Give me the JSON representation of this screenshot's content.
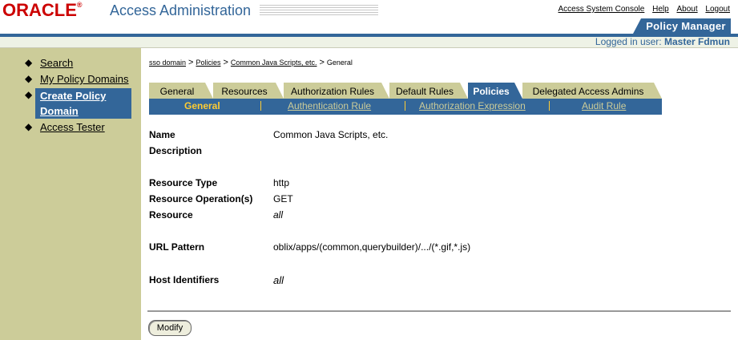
{
  "header": {
    "logo_text": "ORACLE",
    "logo_reg": "®",
    "app_title": "Access Administration",
    "global_links": [
      "Access System Console",
      "Help",
      "About",
      "Logout"
    ],
    "section_tab": "Policy Manager",
    "logged_label": "Logged in user:",
    "logged_user": "Master Fdmun"
  },
  "sidebar": {
    "items": [
      {
        "label": "Search",
        "active": false
      },
      {
        "label": "My Policy Domains",
        "active": false
      },
      {
        "label": "Create Policy Domain",
        "line1": "Create Policy",
        "line2": "Domain",
        "active": true
      },
      {
        "label": "Access Tester",
        "active": false
      }
    ]
  },
  "breadcrumb": {
    "items": [
      "sso domain",
      "Policies",
      "Common Java Scripts, etc."
    ],
    "current": "General",
    "separator": ">"
  },
  "tabs": [
    {
      "label": "General",
      "active": false
    },
    {
      "label": "Resources",
      "active": false
    },
    {
      "label": "Authorization Rules",
      "active": false
    },
    {
      "label": "Default Rules",
      "active": false
    },
    {
      "label": "Policies",
      "active": true
    },
    {
      "label": "Delegated Access Admins",
      "active": false
    }
  ],
  "subtabs": [
    {
      "label": "General",
      "active": true
    },
    {
      "label": "Authentication Rule",
      "active": false
    },
    {
      "label": "Authorization Expression",
      "active": false
    },
    {
      "label": "Audit Rule",
      "active": false
    }
  ],
  "fields": {
    "name": {
      "label": "Name",
      "value": "Common Java Scripts, etc."
    },
    "description": {
      "label": "Description",
      "value": ""
    },
    "resource_type": {
      "label": "Resource Type",
      "value": "http"
    },
    "resource_operations": {
      "label": "Resource Operation(s)",
      "value": "GET"
    },
    "resource": {
      "label": "Resource",
      "value": "all"
    },
    "url_pattern": {
      "label": "URL Pattern",
      "value": "oblix/apps/(common,querybuilder)/.../(*.gif,*.js)"
    },
    "host_identifiers": {
      "label": "Host Identifiers",
      "value": "all"
    }
  },
  "actions": {
    "modify_label": "Modify"
  },
  "colors": {
    "brand_red": "#cc0000",
    "primary_blue": "#336699",
    "sidebar_khaki": "#cccc99",
    "active_subtab": "#ffcc33"
  }
}
